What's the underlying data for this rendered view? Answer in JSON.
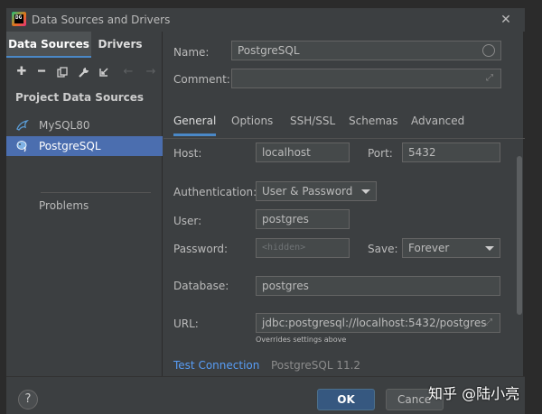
{
  "window": {
    "title": "Data Sources and Drivers",
    "app_icon_text": "DG"
  },
  "left": {
    "tabs": [
      {
        "label": "Data Sources"
      },
      {
        "label": "Drivers"
      }
    ],
    "toolbar": [
      "plus-icon",
      "minus-icon",
      "copy-icon",
      "wrench-icon",
      "import-icon",
      "back-arrow-icon",
      "forward-arrow-icon"
    ],
    "section_title": "Project Data Sources",
    "items": [
      {
        "label": "MySQL80",
        "icon": "mysql-dolphin-icon"
      },
      {
        "label": "PostgreSQL",
        "icon": "postgresql-elephant-icon"
      }
    ],
    "problems_label": "Problems"
  },
  "form": {
    "name_label": "Name:",
    "name_value": "PostgreSQL",
    "comment_label": "Comment:",
    "comment_value": "",
    "tabs": [
      {
        "label": "General"
      },
      {
        "label": "Options"
      },
      {
        "label": "SSH/SSL"
      },
      {
        "label": "Schemas"
      },
      {
        "label": "Advanced"
      }
    ],
    "host_label": "Host:",
    "host_value": "localhost",
    "port_label": "Port:",
    "port_value": "5432",
    "auth_label": "Authentication:",
    "auth_value": "User & Password",
    "user_label": "User:",
    "user_value": "postgres",
    "password_label": "Password:",
    "password_placeholder": "<hidden>",
    "save_label": "Save:",
    "save_value": "Forever",
    "database_label": "Database:",
    "database_value": "postgres",
    "url_label": "URL:",
    "url_value": "jdbc:postgresql://localhost:5432/postgres",
    "url_hint": "Overrides settings above",
    "test_connection": "Test Connection",
    "driver_version": "PostgreSQL 11.2"
  },
  "footer": {
    "help": "?",
    "ok": "OK",
    "cancel": "Cance"
  },
  "watermark": "知乎 @陆小亮",
  "colors": {
    "accent": "#4a88c7",
    "selection": "#4b6eaf",
    "link": "#589df6",
    "ok_button": "#365880"
  }
}
